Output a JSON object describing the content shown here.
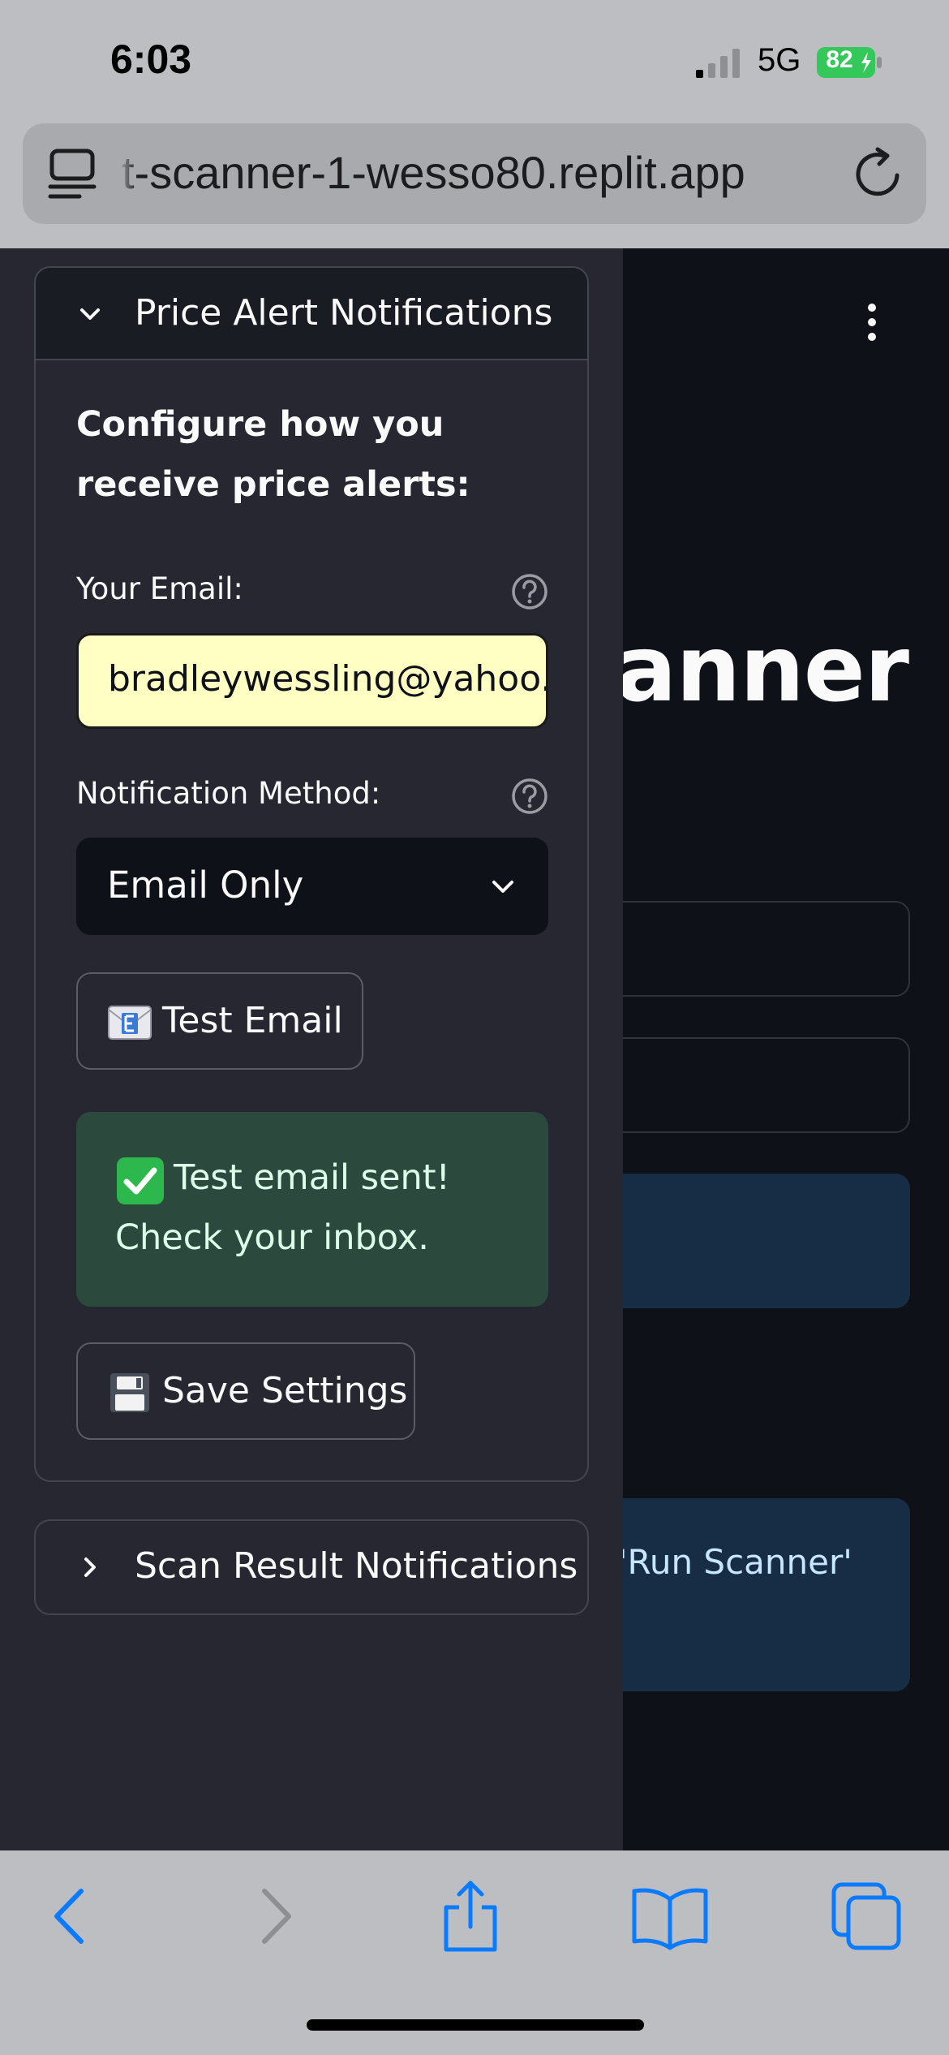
{
  "status_bar": {
    "time": "6:03",
    "network": "5G",
    "battery": "82"
  },
  "browser": {
    "url": "t-scanner-1-wesso80.replit.app"
  },
  "main": {
    "title_fragment": "canner",
    "info_fragment": "'Run Scanner'"
  },
  "sidebar": {
    "price_alert_expander": {
      "title": "Price Alert Notifications",
      "expanded": true,
      "heading": "Configure how you receive price alerts:",
      "email_label": "Your Email:",
      "email_value": "bradleywessling@yahoo.com",
      "method_label": "Notification Method:",
      "method_value": "Email Only",
      "test_email_button": "Test Email",
      "success_line1": "Test email sent!",
      "success_line2": "Check your inbox.",
      "save_button": "Save Settings"
    },
    "scan_result_expander": {
      "title": "Scan Result Notifications",
      "expanded": false
    }
  },
  "colors": {
    "sidebar_bg": "#262730",
    "main_bg": "#0e1117",
    "email_input_bg": "#ffffc4",
    "success_bg": "#2b4a3d",
    "info_bg": "#172d45",
    "safari_accent": "#0a7aff"
  }
}
